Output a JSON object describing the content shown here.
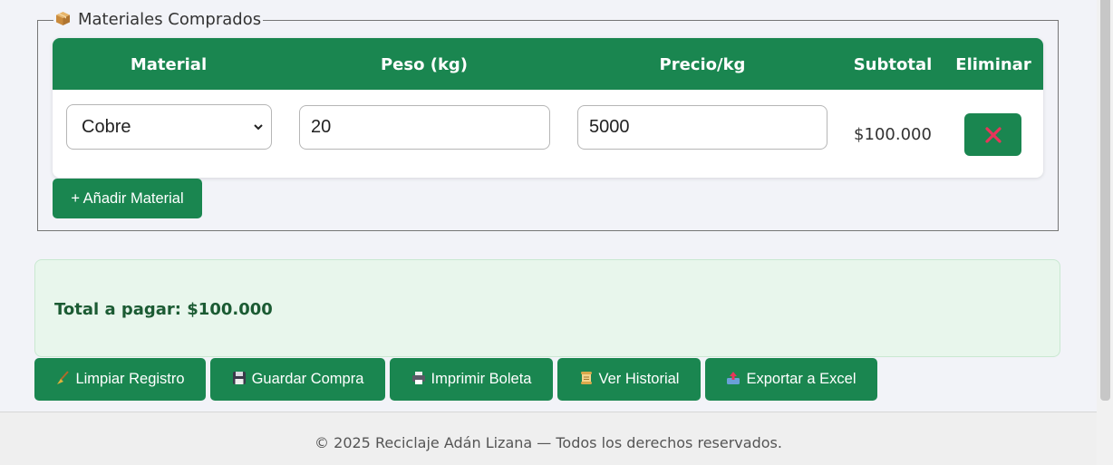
{
  "materials": {
    "legend": "Materiales Comprados",
    "legend_icon": "package-icon",
    "columns": [
      "Material",
      "Peso (kg)",
      "Precio/kg",
      "Subtotal",
      "Eliminar"
    ],
    "rows": [
      {
        "material": "Cobre",
        "weight": "20",
        "price": "5000",
        "subtotal": "$100.000",
        "delete_icon": "close-icon"
      }
    ],
    "add_button": "+ Añadir Material"
  },
  "total": {
    "label": "Total a pagar:",
    "value": "$100.000"
  },
  "actions": [
    {
      "label": "Limpiar Registro",
      "icon": "broom-icon"
    },
    {
      "label": "Guardar Compra",
      "icon": "floppy-disk-icon"
    },
    {
      "label": "Imprimir Boleta",
      "icon": "printer-icon"
    },
    {
      "label": "Ver Historial",
      "icon": "scroll-icon"
    },
    {
      "label": "Exportar a Excel",
      "icon": "outbox-tray-icon"
    }
  ],
  "footer": {
    "text": "© 2025 Reciclaje Adán Lizana — Todos los derechos reservados."
  },
  "colors": {
    "primary_green": "#1a8650",
    "total_bg": "#e8f6ec",
    "total_text": "#1b5b33",
    "delete_x": "#e8355a"
  }
}
